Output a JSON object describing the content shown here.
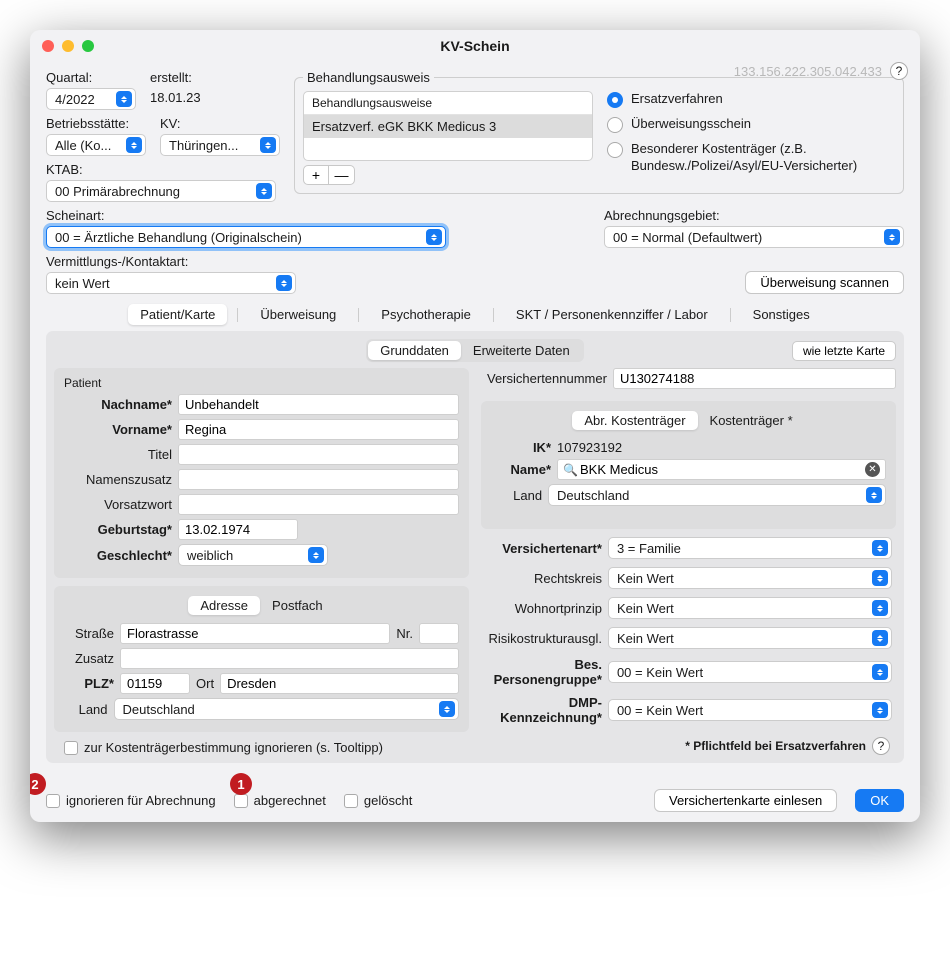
{
  "window": {
    "title": "KV-Schein",
    "header_id": "133.156.222.305.042.433",
    "help": "?"
  },
  "top": {
    "quartal_label": "Quartal:",
    "quartal_value": "4/2022",
    "erstellt_label": "erstellt:",
    "erstellt_value": "18.01.23",
    "betriebsstaette_label": "Betriebsstätte:",
    "betriebsstaette_value": "Alle (Ko...",
    "kv_label": "KV:",
    "kv_value": "Thüringen...",
    "ktab_label": "KTAB:",
    "ktab_value": "00 Primärabrechnung",
    "scheinart_label": "Scheinart:",
    "scheinart_value": "00 = Ärztliche Behandlung (Originalschein)",
    "vermittlung_label": "Vermittlungs-/Kontaktart:",
    "vermittlung_value": "kein Wert",
    "abrechnungsgebiet_label": "Abrechnungsgebiet:",
    "abrechnungsgebiet_value": "00 = Normal (Defaultwert)",
    "ueberweisung_scannen": "Überweisung scannen"
  },
  "behandlungsausweis": {
    "legend": "Behandlungsausweis",
    "list_header": "Behandlungsausweise",
    "item1": "Ersatzverf. eGK BKK Medicus 3",
    "add": "+",
    "remove": "—",
    "radio1": "Ersatzverfahren",
    "radio2": "Überweisungsschein",
    "radio3": "Besonderer Kostenträger (z.B. Bundesw./Polizei/Asyl/EU-Versicherter)"
  },
  "main_tabs": {
    "t1": "Patient/Karte",
    "t2": "Überweisung",
    "t3": "Psychotherapie",
    "t4": "SKT / Personenkennziffer / Labor",
    "t5": "Sonstiges"
  },
  "sub_tabs": {
    "t1": "Grunddaten",
    "t2": "Erweiterte Daten",
    "btn": "wie letzte Karte"
  },
  "patient": {
    "legend": "Patient",
    "nachname_label": "Nachname*",
    "nachname": "Unbehandelt",
    "vorname_label": "Vorname*",
    "vorname": "Regina",
    "titel_label": "Titel",
    "titel": "",
    "namenszusatz_label": "Namenszusatz",
    "namenszusatz": "",
    "vorsatzwort_label": "Vorsatzwort",
    "vorsatzwort": "",
    "geburtstag_label": "Geburtstag*",
    "geburtstag": "13.02.1974",
    "geschlecht_label": "Geschlecht*",
    "geschlecht": "weiblich"
  },
  "adresse_tabs": {
    "t1": "Adresse",
    "t2": "Postfach"
  },
  "adresse": {
    "strasse_label": "Straße",
    "strasse": "Florastrasse",
    "nr_label": "Nr.",
    "nr": "",
    "zusatz_label": "Zusatz",
    "zusatz": "",
    "plz_label": "PLZ*",
    "plz": "01159",
    "ort_label": "Ort",
    "ort": "Dresden",
    "land_label": "Land",
    "land": "Deutschland"
  },
  "ignore_note": "zur Kostenträgerbestimmung ignorieren (s. Tooltipp)",
  "versicherung": {
    "nr_label": "Versichertennummer",
    "nr": "U130274188",
    "tabs": {
      "t1": "Abr. Kostenträger",
      "t2": "Kostenträger *"
    },
    "ik_label": "IK*",
    "ik": "107923192",
    "name_label": "Name*",
    "name": "BKK Medicus",
    "land_label": "Land",
    "land": "Deutschland",
    "art_label": "Versichertenart*",
    "art": "3 = Familie",
    "rechtskreis_label": "Rechtskreis",
    "rechtskreis": "Kein Wert",
    "wohnort_label": "Wohnortprinzip",
    "wohnort": "Kein Wert",
    "risiko_label": "Risikostrukturausgl.",
    "risiko": "Kein Wert",
    "gruppe_label": "Bes. Personengruppe*",
    "gruppe": "00 = Kein Wert",
    "dmp_label": "DMP-Kennzeichnung*",
    "dmp": "00 = Kein Wert",
    "pflicht": "* Pflichtfeld bei Ersatzverfahren",
    "pflicht_help": "?"
  },
  "footer": {
    "ignore": "ignorieren für Abrechnung",
    "abgerechnet": "abgerechnet",
    "geloescht": "gelöscht",
    "einlesen": "Versichertenkarte einlesen",
    "ok": "OK"
  },
  "badges": {
    "b1": "1",
    "b2": "2"
  }
}
